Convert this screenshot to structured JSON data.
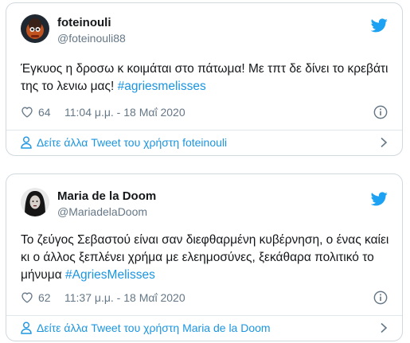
{
  "colors": {
    "accent": "#1b95e0",
    "muted": "#657786",
    "text": "#14171a",
    "border": "#cfd9de"
  },
  "tweets": [
    {
      "display_name": "foteinouli",
      "handle": "@foteinouli88",
      "text_plain": "Έγκυος η δροσω κ κοιμάται στο πάτωμα! Με τπτ δε δίνει το κρεβάτι της το λενιω μας! ",
      "hashtag": "#agriesmelisses",
      "likes": "64",
      "timestamp": "11:04 μ.μ. - 18 Μαΐ 2020",
      "more_link": "Δείτε άλλα Tweet του χρήστη foteinouli",
      "icons": {
        "avatar": "avatar-cartoon",
        "brand": "twitter-bird-icon",
        "like": "heart-icon",
        "info": "info-icon",
        "user": "person-icon",
        "chevron": "chevron-right-icon"
      }
    },
    {
      "display_name": "Maria de la Doom",
      "handle": "@MariadelaDoom",
      "text_plain": "Το ζεύγος Σεβαστού είναι σαν διεφθαρμένη κυβέρνηση, ο ένας καίει κι ο άλλος ξεπλένει χρήμα με ελεημοσύνες, ξεκάθαρα πολιτικό το μήνυμα ",
      "hashtag": "#AgriesMelisses",
      "likes": "62",
      "timestamp": "11:37 μ.μ. - 18 Μαΐ 2020",
      "more_link": "Δείτε άλλα Tweet του χρήστη Maria de la Doom",
      "icons": {
        "avatar": "avatar-photo",
        "brand": "twitter-bird-icon",
        "like": "heart-icon",
        "info": "info-icon",
        "user": "person-icon",
        "chevron": "chevron-right-icon"
      }
    }
  ]
}
